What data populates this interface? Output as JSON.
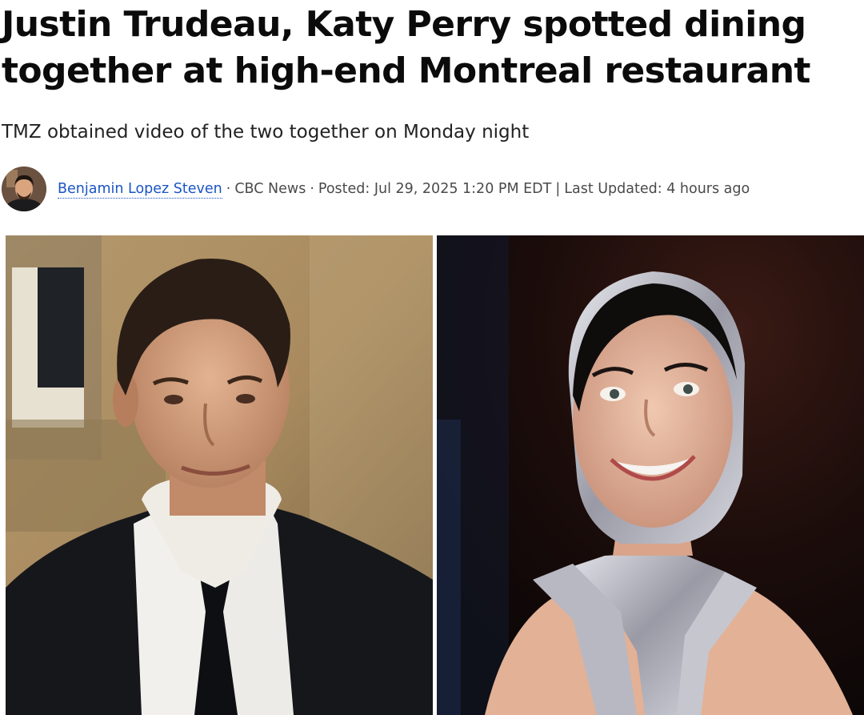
{
  "article": {
    "headline": "Justin Trudeau, Katy Perry spotted dining together at high-end Montreal restaurant",
    "deck": "TMZ obtained video of the two together on Monday night",
    "byline": {
      "author": "Benjamin Lopez Steven",
      "separator": "·",
      "outlet": "CBC News",
      "posted": "Posted: Jul 29, 2025 1:20 PM EDT",
      "divider": "|",
      "updated": "Last Updated: 4 hours ago"
    }
  },
  "colors": {
    "link": "#1a55c4",
    "headline": "#0b0b0b",
    "meta": "#4a4a4a"
  }
}
